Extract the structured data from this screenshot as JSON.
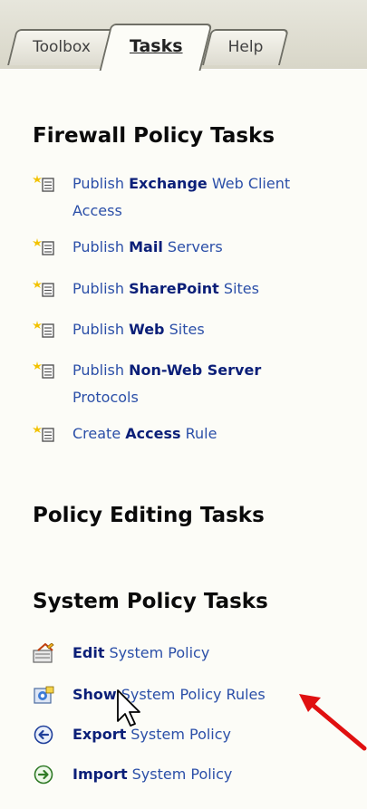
{
  "tabs": [
    {
      "label": "Toolbox"
    },
    {
      "label": "Tasks",
      "active": true
    },
    {
      "label": "Help"
    }
  ],
  "sections": {
    "firewall": {
      "title": "Firewall Policy Tasks",
      "items": [
        {
          "prefix": "Publish",
          "bold": "Exchange",
          "suffix": "Web Client",
          "suffix2": "Access",
          "icon": "new-rule-icon"
        },
        {
          "prefix": "Publish",
          "bold": "Mail",
          "suffix": "Servers",
          "icon": "new-rule-icon"
        },
        {
          "prefix": "Publish",
          "bold": "SharePoint",
          "suffix": "Sites",
          "icon": "new-rule-icon"
        },
        {
          "prefix": "Publish",
          "bold": "Web",
          "suffix": "Sites",
          "icon": "new-rule-icon"
        },
        {
          "prefix": "Publish",
          "bold": "Non-Web Server",
          "suffix": "",
          "suffix2": "Protocols",
          "icon": "new-rule-icon"
        },
        {
          "prefix": "Create",
          "bold": "Access",
          "suffix": "Rule",
          "icon": "new-rule-icon"
        }
      ]
    },
    "editing": {
      "title": "Policy Editing Tasks"
    },
    "system": {
      "title": "System Policy Tasks",
      "items": [
        {
          "bold": "Edit",
          "suffix": "System Policy",
          "icon": "edit-policy-icon"
        },
        {
          "bold": "Show",
          "suffix": "System Policy Rules",
          "icon": "show-rules-icon"
        },
        {
          "bold": "Export",
          "suffix": "System Policy",
          "icon": "export-icon"
        },
        {
          "bold": "Import",
          "suffix": "System Policy",
          "icon": "import-icon"
        }
      ]
    }
  },
  "colors": {
    "link": "#2b4fa8",
    "link_bold": "#0b1f78",
    "annotation_arrow": "#e01010"
  }
}
